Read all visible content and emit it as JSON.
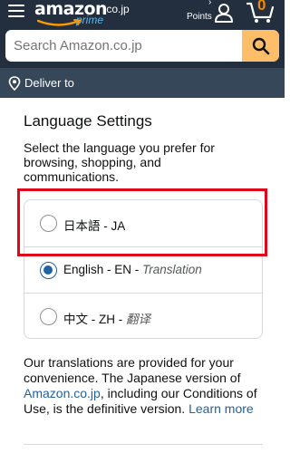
{
  "header": {
    "logo": "amazon",
    "logo_suffix": ".co.jp",
    "logo_prime": "prime",
    "points_label": "Points",
    "points_caret": "›",
    "cart_count": "0"
  },
  "search": {
    "placeholder": "Search Amazon.co.jp"
  },
  "deliver": {
    "label": "Deliver to"
  },
  "language": {
    "title": "Language Settings",
    "description": "Select the language you prefer for browsing, shopping, and communications.",
    "options": [
      {
        "label": "日本語 - JA",
        "note": "",
        "selected": false
      },
      {
        "label": "English - EN - ",
        "note": "Translation",
        "selected": true
      },
      {
        "label": "中文 - ZH - ",
        "note": "翻译",
        "selected": false
      }
    ]
  },
  "footer": {
    "text_1": "Our translations are provided for your convenience. The Japanese version of ",
    "link_1": "Amazon.co.jp",
    "text_2": ", including our Conditions of Use, is the definitive version. ",
    "link_2": "Learn more"
  },
  "colors": {
    "header_bg": "#232f3e",
    "subheader_bg": "#37475a",
    "search_button": "#febd69",
    "cart_count": "#f08804",
    "link": "#2162a1",
    "highlight_box": "#e0071b"
  }
}
